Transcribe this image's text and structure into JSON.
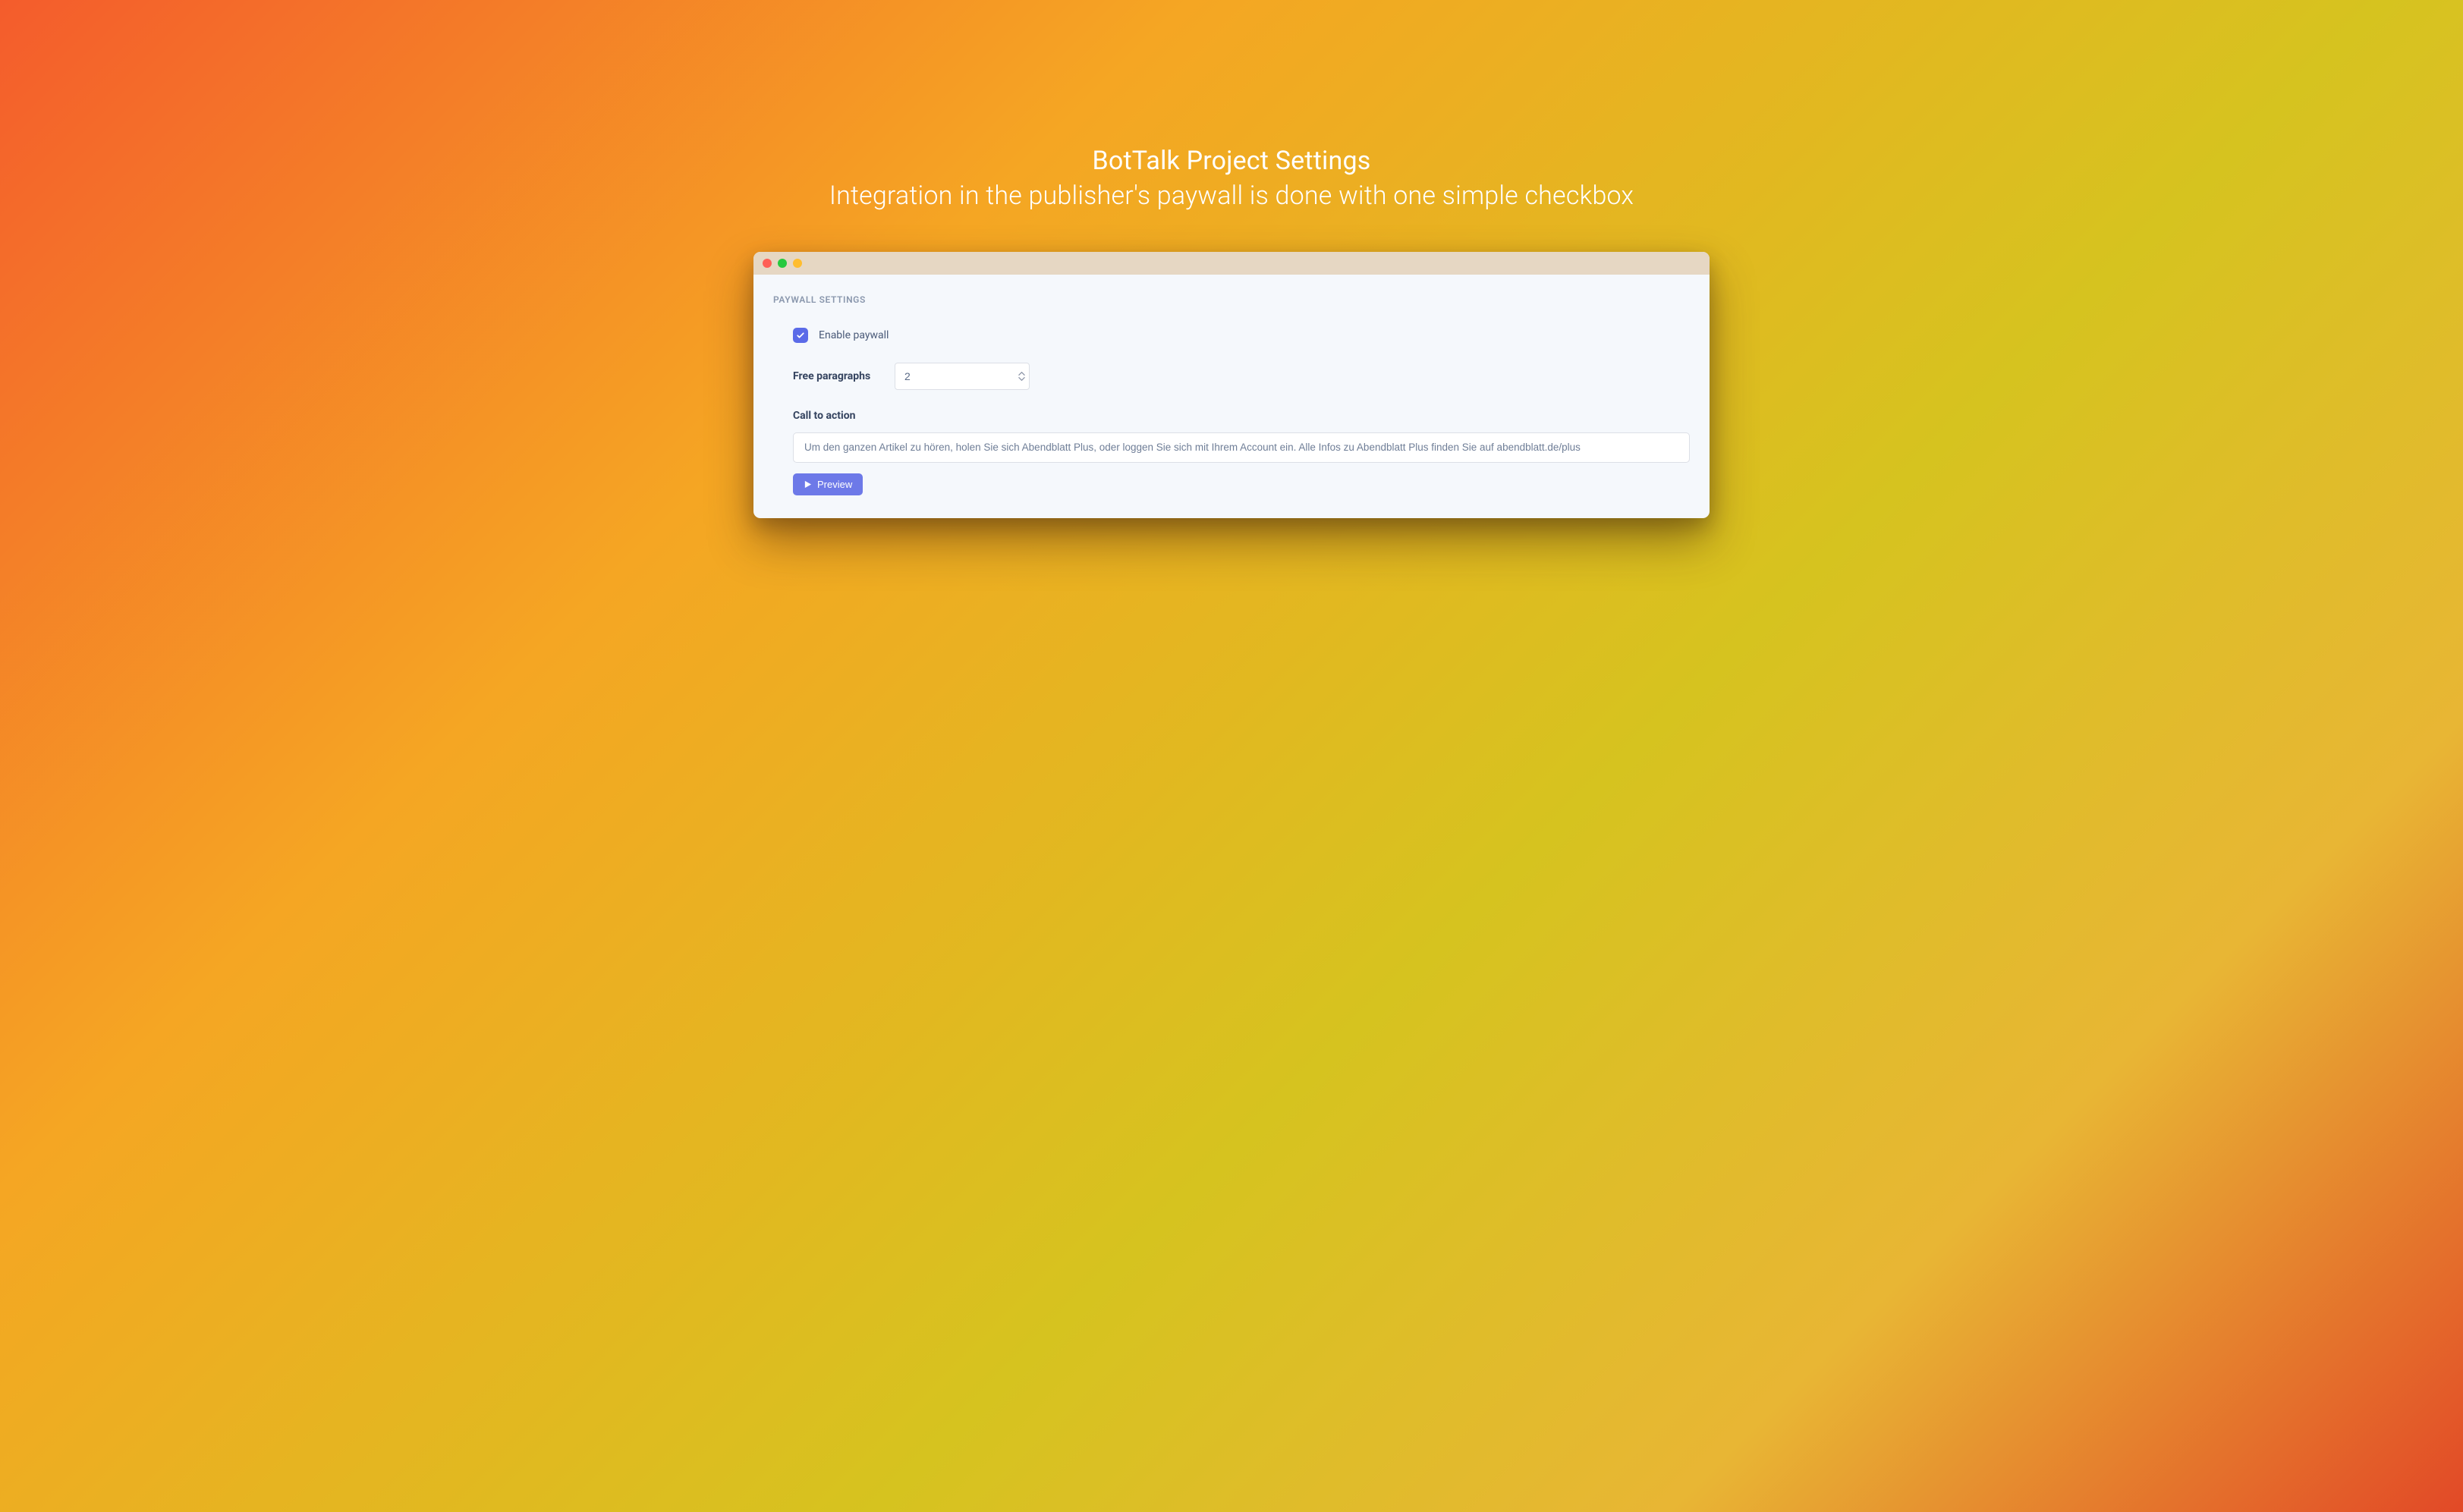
{
  "hero": {
    "title": "BotTalk Project Settings",
    "subtitle": "Integration in the publisher's paywall is done with one simple checkbox"
  },
  "window": {
    "section_title": "PAYWALL SETTINGS",
    "enable_paywall": {
      "label": "Enable paywall",
      "checked": true
    },
    "free_paragraphs": {
      "label": "Free paragraphs",
      "value": "2"
    },
    "call_to_action": {
      "label": "Call to action",
      "value": "Um den ganzen Artikel zu hören, holen Sie sich Abendblatt Plus, oder loggen Sie sich mit Ihrem Account ein. Alle Infos zu Abendblatt Plus finden Sie auf abendblatt.de/plus"
    },
    "preview_button": "Preview"
  },
  "colors": {
    "accent": "#5b6be8",
    "button": "#6d79e8"
  }
}
